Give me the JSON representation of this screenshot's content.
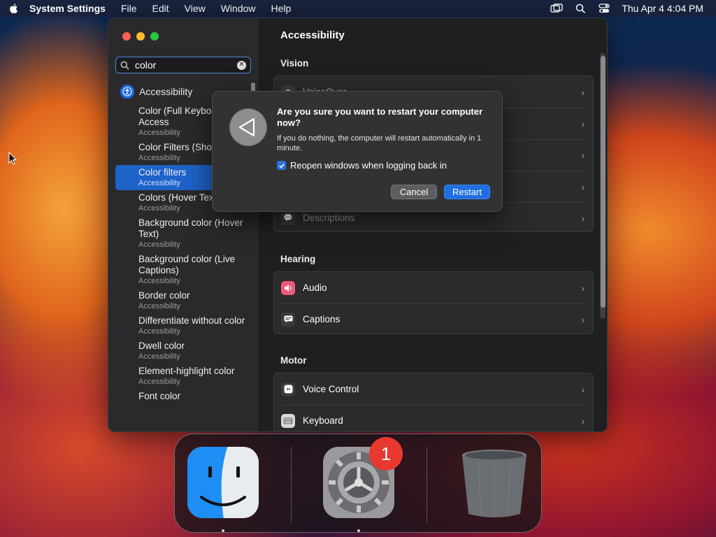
{
  "menubar": {
    "app_name": "System Settings",
    "menus": [
      "File",
      "Edit",
      "View",
      "Window",
      "Help"
    ],
    "clock": "Thu Apr 4  4:04 PM"
  },
  "sidebar": {
    "search": {
      "value": "color",
      "placeholder": "Search"
    },
    "section_label": "Accessibility",
    "results": [
      {
        "title": "Color (Full Keyboard Access",
        "subtitle": "Accessibility",
        "selected": false
      },
      {
        "title": "Color Filters (Sho",
        "subtitle": "Accessibility",
        "selected": false
      },
      {
        "title": "Color filters",
        "subtitle": "Accessibility",
        "selected": true
      },
      {
        "title": "Colors (Hover Tex",
        "subtitle": "Accessibility",
        "selected": false
      },
      {
        "title": "Background color (Hover Text)",
        "subtitle": "Accessibility",
        "selected": false
      },
      {
        "title": "Background color (Live Captions)",
        "subtitle": "Accessibility",
        "selected": false
      },
      {
        "title": "Border color",
        "subtitle": "Accessibility",
        "selected": false
      },
      {
        "title": "Differentiate without color",
        "subtitle": "Accessibility",
        "selected": false
      },
      {
        "title": "Dwell color",
        "subtitle": "Accessibility",
        "selected": false
      },
      {
        "title": "Element-highlight color",
        "subtitle": "Accessibility",
        "selected": false
      },
      {
        "title": "Font color",
        "subtitle": "",
        "selected": false
      }
    ]
  },
  "content": {
    "title": "Accessibility",
    "sections": {
      "vision": {
        "label": "Vision",
        "rows": [
          "VoiceOver",
          "",
          "",
          "",
          "Descriptions"
        ]
      },
      "hearing": {
        "label": "Hearing",
        "rows": [
          "Audio",
          "Captions"
        ]
      },
      "motor": {
        "label": "Motor",
        "rows": [
          "Voice Control",
          "Keyboard"
        ]
      }
    }
  },
  "dialog": {
    "title": "Are you sure you want to restart your computer now?",
    "message": "If you do nothing, the computer will restart automatically in 1 minute.",
    "checkbox_label": "Reopen windows when logging back in",
    "checkbox_checked": true,
    "cancel_label": "Cancel",
    "restart_label": "Restart"
  },
  "dock": {
    "apps": [
      "Finder",
      "System Settings",
      "Trash"
    ],
    "settings_badge": "1"
  },
  "colors": {
    "accent": "#1e63c9",
    "badge": "#e8382f"
  }
}
